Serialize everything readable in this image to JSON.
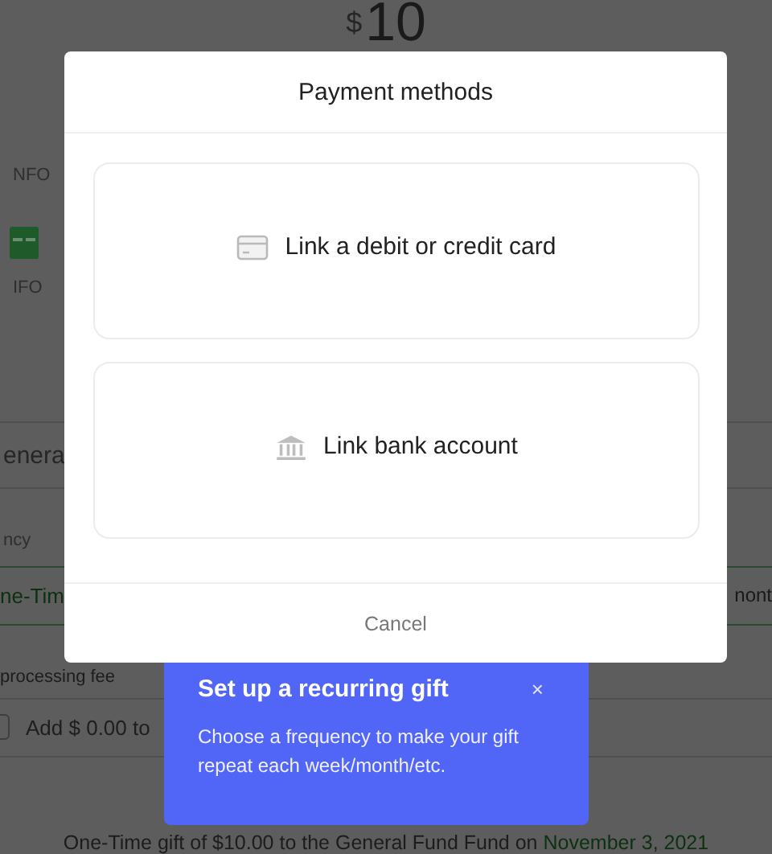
{
  "background": {
    "amount_currency": "$",
    "amount": "10",
    "section_labels": [
      "NFO",
      "IFO"
    ],
    "fund_value": "enera",
    "frequency_label": "ncy",
    "frequency_selected": "ne-Tim",
    "frequency_other": "nont",
    "fee_label": "processing fee",
    "fee_checkbox": {
      "label": "Add $ 0.00 to",
      "checked": false
    },
    "summary": {
      "text": "One-Time gift of $10.00 to the General Fund Fund on ",
      "date": "November 3, 2021"
    }
  },
  "modal": {
    "title": "Payment methods",
    "options": [
      {
        "kind": "card",
        "label": "Link a debit or credit card"
      },
      {
        "kind": "bank",
        "label": "Link bank account"
      }
    ],
    "cancel": "Cancel"
  },
  "tooltip": {
    "title": "Set up a recurring gift",
    "close": "×",
    "body": "Choose a frequency to make your gift repeat each week/month/etc."
  }
}
